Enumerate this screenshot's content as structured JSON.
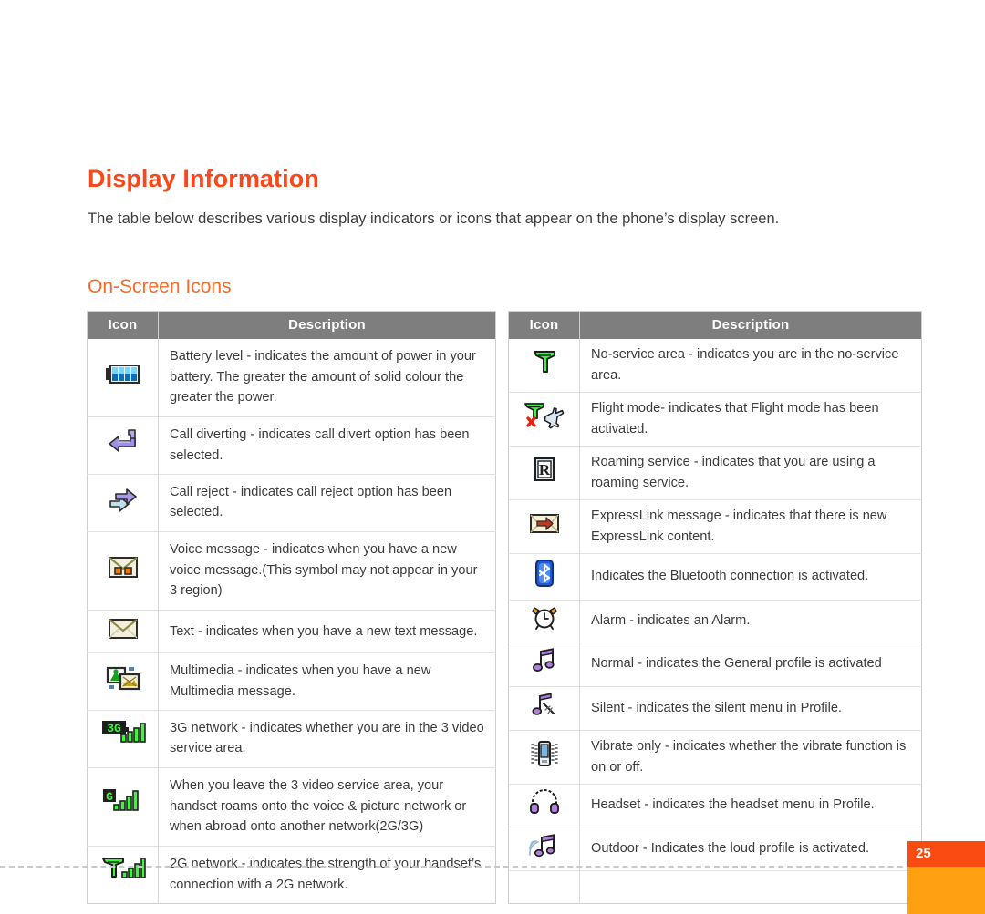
{
  "page": {
    "heading": "Display Information",
    "intro": "The table below describes various display indicators or icons that appear on the phone’s display screen.",
    "subheading": "On-Screen Icons",
    "page_number": "25",
    "colors": {
      "heading_orange": "#f8481c",
      "subheading_orange": "#fa6a26",
      "table_header_gray": "#7e7e7e",
      "tab_top": "#fa4b10",
      "tab_bottom": "#ffa012"
    }
  },
  "tables": {
    "left": {
      "headers": [
        "Icon",
        "Description"
      ],
      "rows": [
        {
          "icon": "battery-level-icon",
          "description": "Battery level - indicates the amount of power in your battery. The greater the amount of solid colour the greater the power."
        },
        {
          "icon": "call-diverting-icon",
          "description": "Call diverting - indicates call divert option has been selected."
        },
        {
          "icon": "call-reject-icon",
          "description": "Call reject - indicates call reject option has been selected."
        },
        {
          "icon": "voice-message-icon",
          "description": "Voice message - indicates when you have a new voice message.(This symbol may not appear in your 3 region)"
        },
        {
          "icon": "text-message-icon",
          "description": "Text - indicates when you have a new text message."
        },
        {
          "icon": "multimedia-message-icon",
          "description": "Multimedia - indicates when you have a new Multimedia message."
        },
        {
          "icon": "3g-network-icon",
          "description": "3G network - indicates whether you are in the 3 video service area."
        },
        {
          "icon": "gprs-network-icon",
          "description": "When you leave the 3 video service area, your handset roams onto the voice & picture network or when abroad onto another network(2G/3G)"
        },
        {
          "icon": "2g-network-icon",
          "description": "2G network - indicates the strength of your handset’s connection with a 2G network."
        }
      ]
    },
    "right": {
      "headers": [
        "Icon",
        "Description"
      ],
      "rows": [
        {
          "icon": "no-service-icon",
          "description": "No-service area - indicates you are in the no-service area."
        },
        {
          "icon": "flight-mode-icon",
          "description": "Flight mode- indicates that Flight mode has been activated."
        },
        {
          "icon": "roaming-service-icon",
          "description": "Roaming service - indicates that you are using a roaming service."
        },
        {
          "icon": "expresslink-message-icon",
          "description": "ExpressLink message - indicates that there is new ExpressLink content."
        },
        {
          "icon": "bluetooth-icon",
          "description": "Indicates the Bluetooth connection is activated."
        },
        {
          "icon": "alarm-clock-icon",
          "description": "Alarm - indicates an Alarm."
        },
        {
          "icon": "normal-profile-icon",
          "description": "Normal - indicates the General profile is activated"
        },
        {
          "icon": "silent-profile-icon",
          "description": "Silent - indicates the silent menu in Profile."
        },
        {
          "icon": "vibrate-only-icon",
          "description": "Vibrate only - indicates whether the vibrate function is on or off."
        },
        {
          "icon": "headset-profile-icon",
          "description": "Headset - indicates the headset menu in Profile."
        },
        {
          "icon": "outdoor-profile-icon",
          "description": "Outdoor - Indicates the loud profile is activated."
        }
      ]
    }
  }
}
